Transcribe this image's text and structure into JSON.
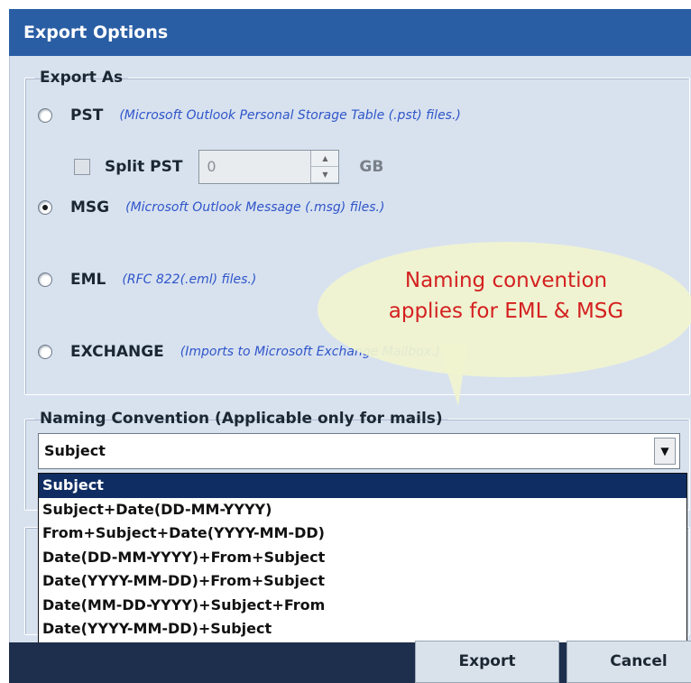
{
  "window": {
    "title": "Export Options"
  },
  "export_as": {
    "legend": "Export As",
    "options": [
      {
        "label": "PST",
        "desc": "(Microsoft Outlook Personal Storage Table (.pst) files.)",
        "checked": false
      },
      {
        "label": "MSG",
        "desc": "(Microsoft Outlook Message (.msg) files.)",
        "checked": true
      },
      {
        "label": "EML",
        "desc": "(RFC 822(.eml) files.)",
        "checked": false
      },
      {
        "label": "EXCHANGE",
        "desc": "(Imports to Microsoft Exchange Mailbox.)",
        "checked": false
      }
    ],
    "split": {
      "label": "Split PST",
      "checked": false,
      "value": "0",
      "unit": "GB"
    }
  },
  "callout": {
    "line1": "Naming convention",
    "line2": "applies for EML & MSG",
    "color": "#d42020"
  },
  "naming": {
    "legend": "Naming Convention (Applicable only for mails)",
    "selected": "Subject",
    "options": [
      "Subject",
      "Subject+Date(DD-MM-YYYY)",
      "From+Subject+Date(YYYY-MM-DD)",
      "Date(DD-MM-YYYY)+From+Subject",
      "Date(YYYY-MM-DD)+From+Subject",
      "Date(MM-DD-YYYY)+Subject+From",
      "Date(YYYY-MM-DD)+Subject"
    ]
  },
  "buttons": {
    "export": "Export",
    "cancel": "Cancel"
  },
  "colors": {
    "title_bar": "#2a5ea4",
    "panel": "#d8e2ef",
    "desc_text": "#2f55c9",
    "selected_item": "#0f2d63"
  }
}
